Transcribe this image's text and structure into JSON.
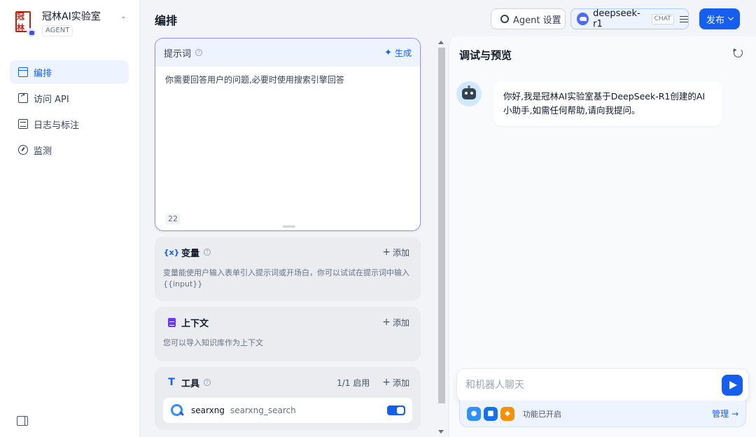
{
  "app": {
    "name": "冠林AI实验室",
    "tag": "AGENT",
    "logo_text": "冠林"
  },
  "sidebar": {
    "items": [
      {
        "label": "编排",
        "icon": "layout-icon",
        "active": true
      },
      {
        "label": "访问 API",
        "icon": "terminal-icon",
        "active": false
      },
      {
        "label": "日志与标注",
        "icon": "document-icon",
        "active": false
      },
      {
        "label": "监测",
        "icon": "gauge-icon",
        "active": false
      }
    ]
  },
  "header": {
    "title": "编排",
    "agent_settings_label": "Agent 设置",
    "model_name": "deepseek-r1",
    "model_badge": "CHAT",
    "publish_label": "发布"
  },
  "prompt": {
    "title": "提示词",
    "generate_label": "生成",
    "text": "你需要回答用户的问题,必要时使用搜索引擎回答",
    "char_count": "22"
  },
  "variables": {
    "icon": "{x}",
    "title": "变量",
    "add_label": "添加",
    "description": "变量能使用户输入表单引入提示词或开场白，你可以试试在提示词中输入 {{input}}"
  },
  "context": {
    "title": "上下文",
    "add_label": "添加",
    "description": "您可以导入知识库作为上下文"
  },
  "tools": {
    "title": "工具",
    "status": "1/1 启用",
    "add_label": "添加",
    "items": [
      {
        "name": "searxng",
        "id": "searxng_search",
        "enabled": true
      }
    ]
  },
  "debug": {
    "title": "调试与预览",
    "bot_message": "你好,我是冠林AI实验室基于DeepSeek-R1创建的AI小助手,如需任何帮助,请向我提问。",
    "input_placeholder": "和机器人聊天",
    "feature_status": "功能已开启",
    "manage_label": "管理 →"
  },
  "colors": {
    "accent": "#155eef",
    "active_bg": "#eef4ff",
    "prompt_border": "#9b8afb"
  }
}
